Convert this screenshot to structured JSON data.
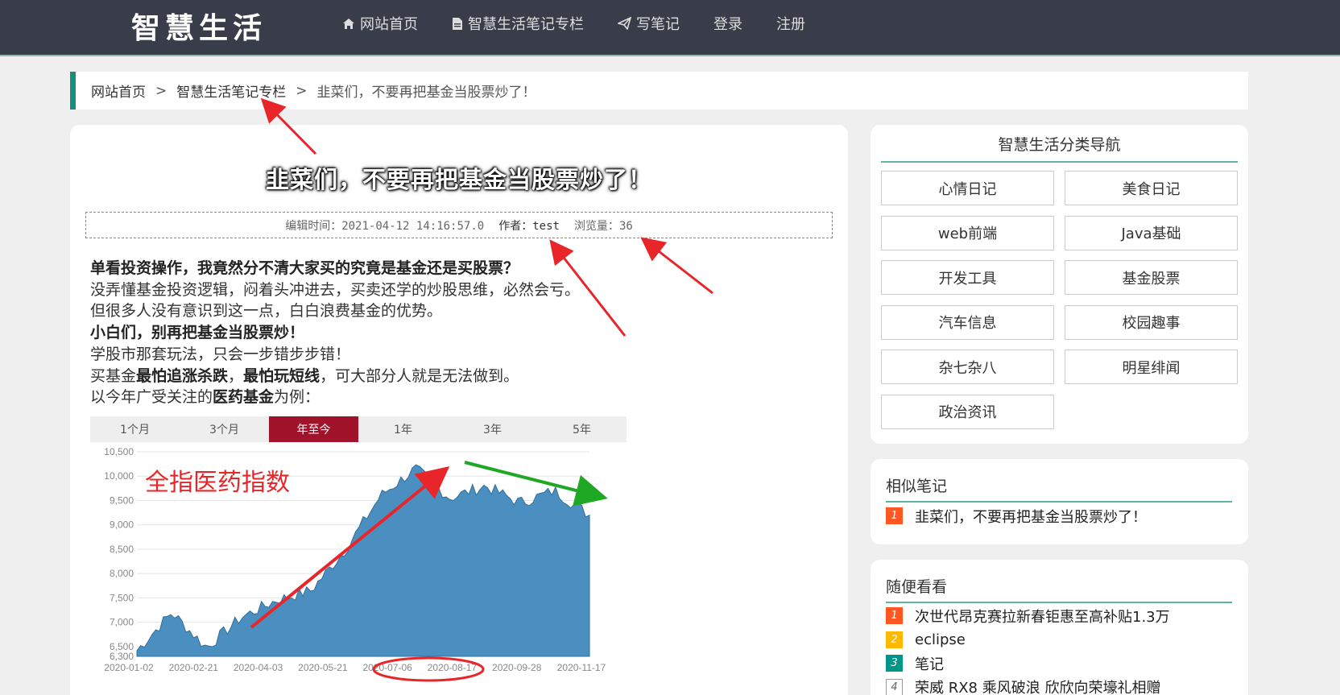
{
  "header": {
    "logo": "智慧生活",
    "nav": [
      {
        "label": "网站首页",
        "icon": "home-icon"
      },
      {
        "label": "智慧生活笔记专栏",
        "icon": "document-icon"
      },
      {
        "label": "写笔记",
        "icon": "send-icon"
      },
      {
        "label": "登录"
      },
      {
        "label": "注册"
      }
    ]
  },
  "breadcrumb": {
    "home": "网站首页",
    "column": "智慧生活笔记专栏",
    "current": "韭菜们，不要再把基金当股票炒了！",
    "separator": ">"
  },
  "article": {
    "title": "韭菜们，不要再把基金当股票炒了！",
    "meta": {
      "edit_time": "编辑时间：2021-04-12 14:16:57.0",
      "author_label": "作者：",
      "author": "test",
      "views_label": "浏览量：",
      "views": "36"
    },
    "lines": {
      "l1": "单看投资操作，我竟然分不清大家买的究竟是基金还是买股票？",
      "l2": "没弄懂基金投资逻辑，闷着头冲进去，买卖还学的炒股思维，必然会亏。",
      "l3": "但很多人没有意识到这一点，白白浪费基金的优势。",
      "l4": "小白们，别再把基金当股票炒！",
      "l5": "学股市那套玩法，只会一步错步步错！",
      "l6a": "买基金",
      "l6b": "最怕追涨杀跌",
      "l6c": "，",
      "l6d": "最怕玩短线",
      "l6e": "，可大部分人就是无法做到。",
      "l7a": "以今年广受关注的",
      "l7b": "医药基金",
      "l7c": "为例："
    },
    "chart_tabs": [
      "1个月",
      "3个月",
      "年至今",
      "1年",
      "3年",
      "5年"
    ],
    "chart_tab_active": "年至今",
    "accent_red": "#a0132b"
  },
  "chart_data": {
    "type": "area",
    "title": "全指医药指数",
    "x": [
      "2020-01-02",
      "2020-02-21",
      "2020-04-03",
      "2020-05-21",
      "2020-07-06",
      "2020-08-17",
      "2020-09-28",
      "2020-11-17"
    ],
    "series": [
      {
        "values": [
          6420,
          7200,
          6480,
          7100,
          7450,
          7650,
          8500,
          9600,
          10150,
          9550,
          9800,
          9450,
          9700,
          9200
        ]
      }
    ],
    "ylim": [
      6300,
      10500
    ],
    "yticks": [
      "10,500",
      "10,000",
      "9,500",
      "9,000",
      "8,500",
      "8,000",
      "7,500",
      "7,000",
      "6,500",
      "6,300"
    ],
    "color": "#4a8fc0",
    "grid": true
  },
  "sidebar": {
    "category_title": "智慧生活分类导航",
    "categories": [
      "心情日记",
      "美食日记",
      "web前端",
      "Java基础",
      "开发工具",
      "基金股票",
      "汽车信息",
      "校园趣事",
      "杂七杂八",
      "明星绯闻",
      "政治资讯"
    ],
    "similar_title": "相似笔记",
    "similar": [
      {
        "num": "1",
        "text": "韭菜们，不要再把基金当股票炒了！"
      }
    ],
    "random_title": "随便看看",
    "random": [
      {
        "num": "1",
        "text": "次世代昂克赛拉新春钜惠至高补贴1.3万"
      },
      {
        "num": "2",
        "text": "eclipse"
      },
      {
        "num": "3",
        "text": "笔记"
      },
      {
        "num": "4",
        "text": "荣威 RX8 乘风破浪 欣欣向荣壕礼相赠"
      }
    ]
  }
}
